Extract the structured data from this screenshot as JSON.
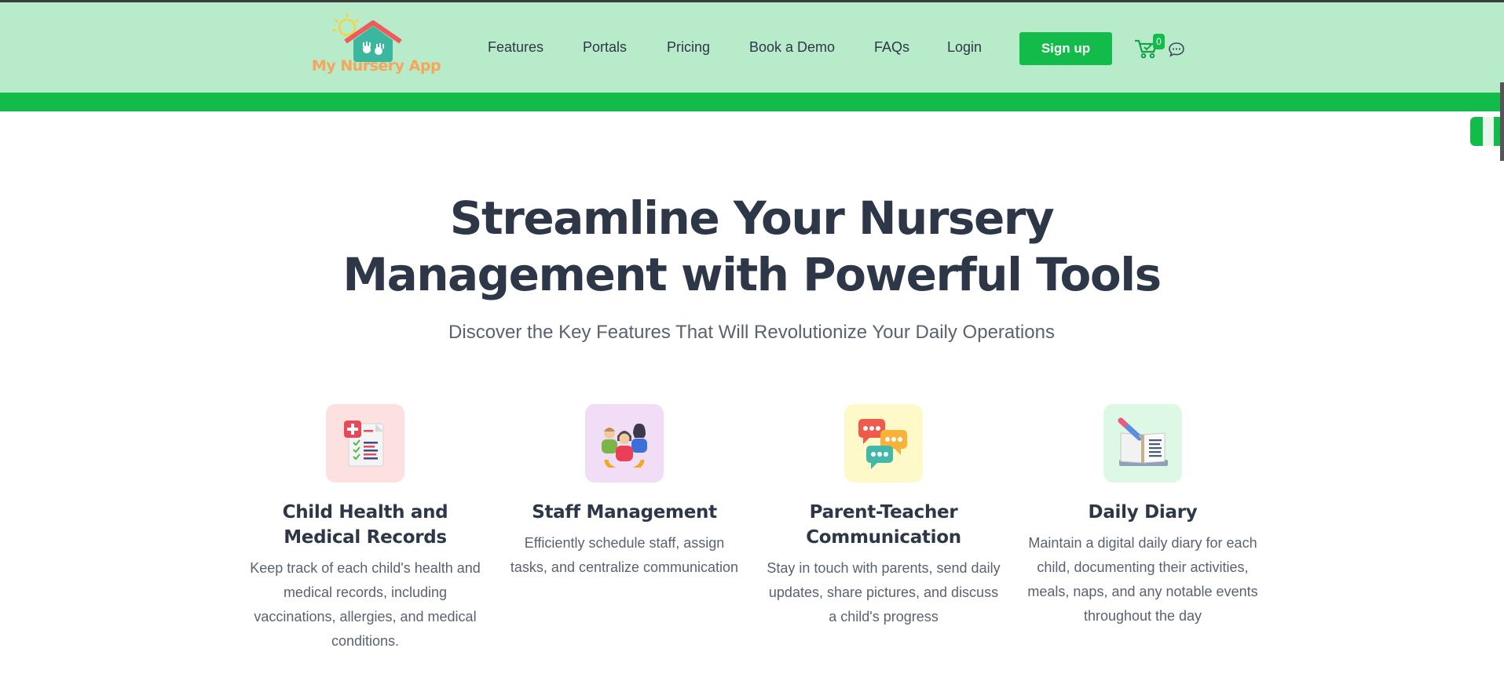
{
  "brand": {
    "logo_text": "My Nursery App"
  },
  "nav": {
    "items": [
      {
        "label": "Features"
      },
      {
        "label": "Portals"
      },
      {
        "label": "Pricing"
      },
      {
        "label": "Book a Demo"
      },
      {
        "label": "FAQs"
      },
      {
        "label": "Login"
      }
    ],
    "signup_label": "Sign up",
    "cart_count": "0"
  },
  "hero": {
    "title_line1": "Streamline Your Nursery",
    "title_line2": "Management with Powerful Tools",
    "subtitle": "Discover the Key Features That Will Revolutionize Your Daily Operations"
  },
  "features": [
    {
      "title": "Child Health and Medical Records",
      "description": "Keep track of each child's health and medical records, including vaccinations, allergies, and medical conditions.",
      "icon": "medical-record-icon",
      "bg": "#fde0e0"
    },
    {
      "title": "Staff Management",
      "description": "Efficiently schedule staff, assign tasks, and centralize communication",
      "icon": "team-icon",
      "bg": "#f1ddf5"
    },
    {
      "title": "Parent-Teacher Communication",
      "description": "Stay in touch with parents, send daily updates, share pictures, and discuss a child's progress",
      "icon": "chat-bubbles-icon",
      "bg": "#fdf9c8"
    },
    {
      "title": "Daily Diary",
      "description": "Maintain a digital daily diary for each child, documenting their activities, meals, naps, and any notable events throughout the day",
      "icon": "diary-icon",
      "bg": "#def8e6"
    }
  ],
  "colors": {
    "header_bg": "#b8ebca",
    "accent": "#13bb4a",
    "heading": "#2d3748",
    "body_text": "#5a6270"
  }
}
